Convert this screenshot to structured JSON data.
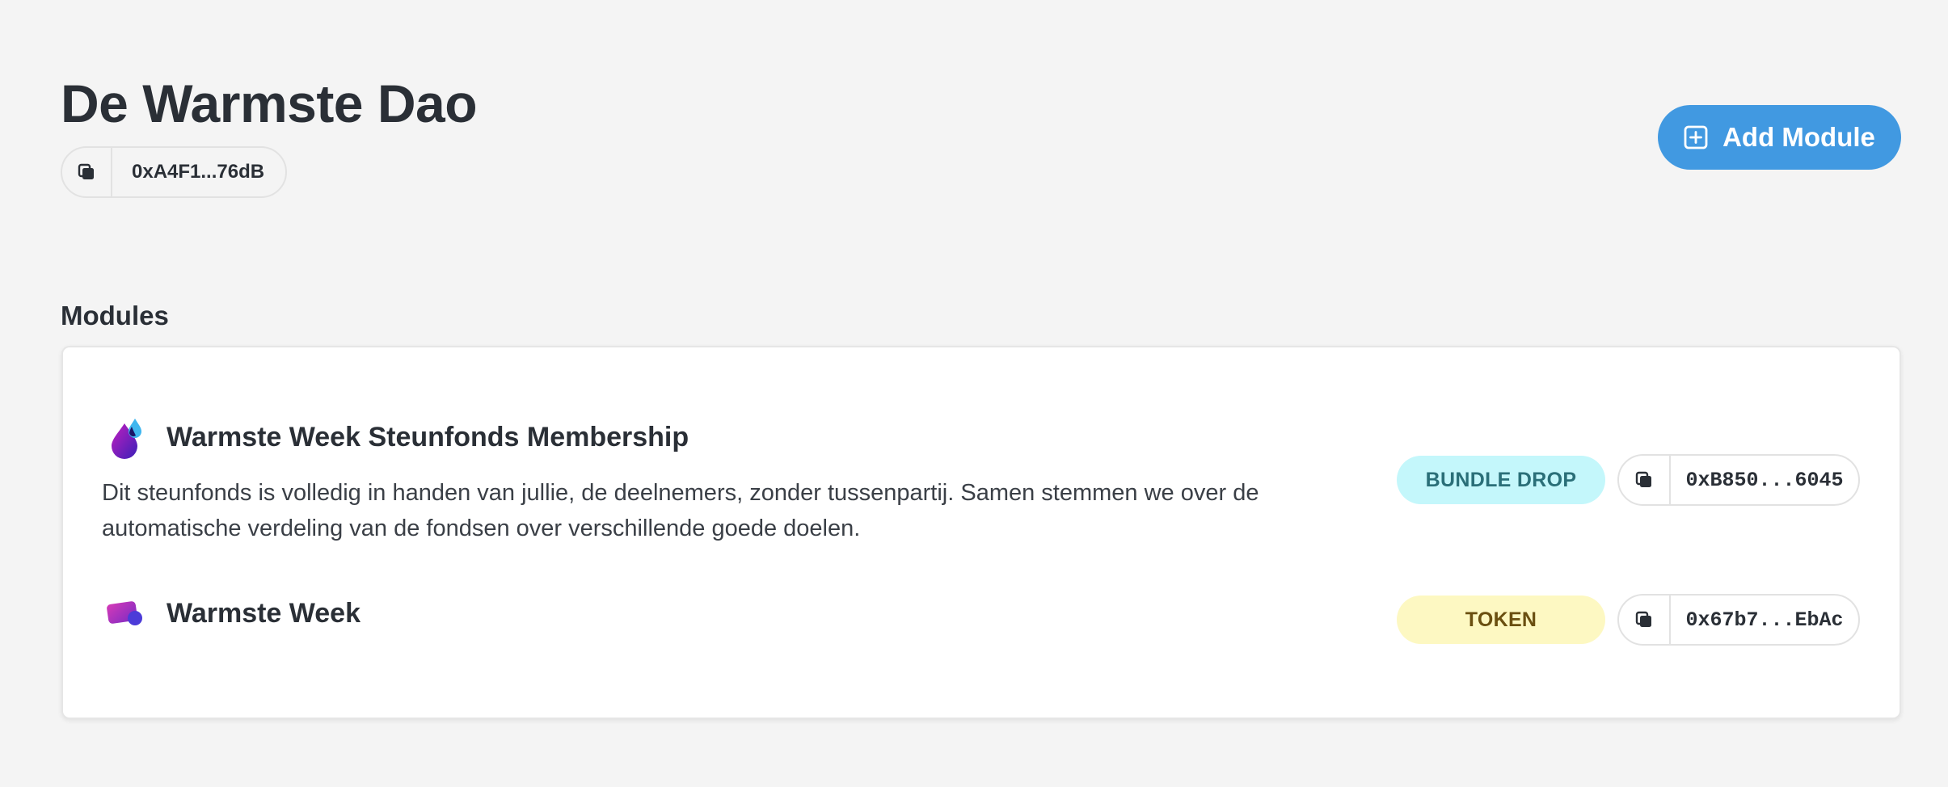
{
  "header": {
    "title": "De Warmste Dao",
    "address": "0xA4F1...76dB",
    "add_module_label": "Add Module"
  },
  "modules_section": {
    "title": "Modules",
    "items": [
      {
        "icon": "bundle-drop-icon",
        "title": "Warmste Week Steunfonds Membership",
        "description": "Dit steunfonds is volledig in handen van jullie, de deelnemers, zonder tussenpartij. Samen stemmen we over de automatische verdeling van de fondsen over verschillende goede doelen.",
        "type": "BUNDLE DROP",
        "address": "0xB850...6045"
      },
      {
        "icon": "token-icon",
        "title": "Warmste Week",
        "description": "",
        "type": "TOKEN",
        "address": "0x67b7...EbAc"
      }
    ]
  },
  "colors": {
    "accent": "#4199e1",
    "background": "#f4f4f4",
    "bundle_badge_bg": "#c4f7fb",
    "token_badge_bg": "#fdf8c2"
  }
}
